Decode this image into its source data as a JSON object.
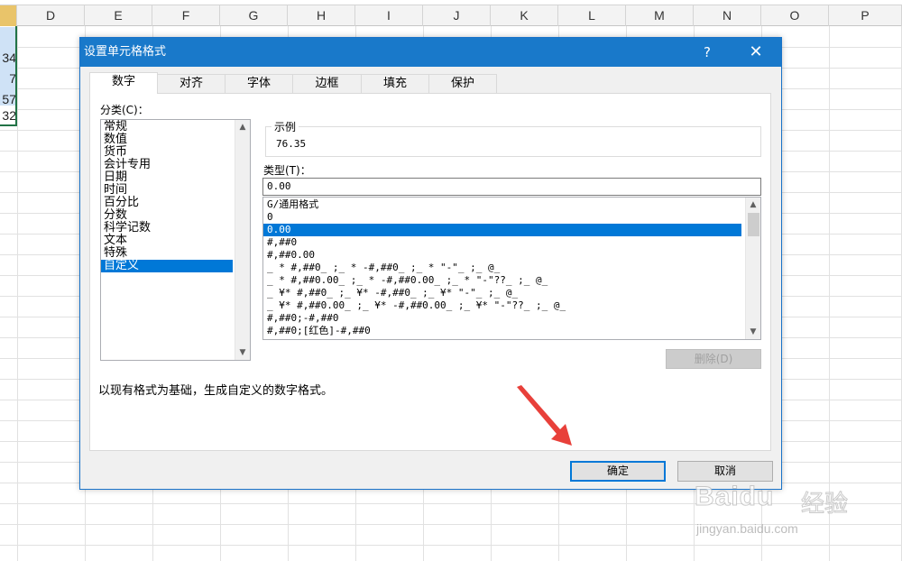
{
  "spreadsheet": {
    "columns": [
      "D",
      "E",
      "F",
      "G",
      "H",
      "I",
      "J",
      "K",
      "L",
      "M",
      "N",
      "O",
      "P"
    ],
    "partial_values": [
      "34",
      "7",
      "57",
      "32"
    ]
  },
  "dialog": {
    "title": "设置单元格格式",
    "help_label": "?",
    "close_label": "✕",
    "tabs": [
      "数字",
      "对齐",
      "字体",
      "边框",
      "填充",
      "保护"
    ],
    "active_tab": "数字",
    "category_label": "分类(C)：",
    "categories": [
      "常规",
      "数值",
      "货币",
      "会计专用",
      "日期",
      "时间",
      "百分比",
      "分数",
      "科学记数",
      "文本",
      "特殊",
      "自定义"
    ],
    "selected_category": "自定义",
    "sample_label": "示例",
    "sample_value": "76.35",
    "type_label": "类型(T)：",
    "type_value": "0.00",
    "format_list": [
      "G/通用格式",
      "0",
      "0.00",
      "#,##0",
      "#,##0.00",
      "_ * #,##0_ ;_ * -#,##0_ ;_ * \"-\"_ ;_ @_",
      "_ * #,##0.00_ ;_ * -#,##0.00_ ;_ * \"-\"??_ ;_ @_",
      "_ ¥* #,##0_ ;_ ¥* -#,##0_ ;_ ¥* \"-\"_ ;_ @_",
      "_ ¥* #,##0.00_ ;_ ¥* -#,##0.00_ ;_ ¥* \"-\"??_ ;_ @_",
      "#,##0;-#,##0",
      "#,##0;[红色]-#,##0"
    ],
    "selected_format": "0.00",
    "delete_label": "删除(D)",
    "description": "以现有格式为基础，生成自定义的数字格式。",
    "ok_label": "确定",
    "cancel_label": "取消"
  },
  "watermark": {
    "main": "Baidu",
    "cn": "经验",
    "sub": "jingyan.baidu.com"
  },
  "colors": {
    "titlebar": "#1979ca",
    "selection": "#0078d7",
    "annotation_arrow": "#e8403a"
  }
}
